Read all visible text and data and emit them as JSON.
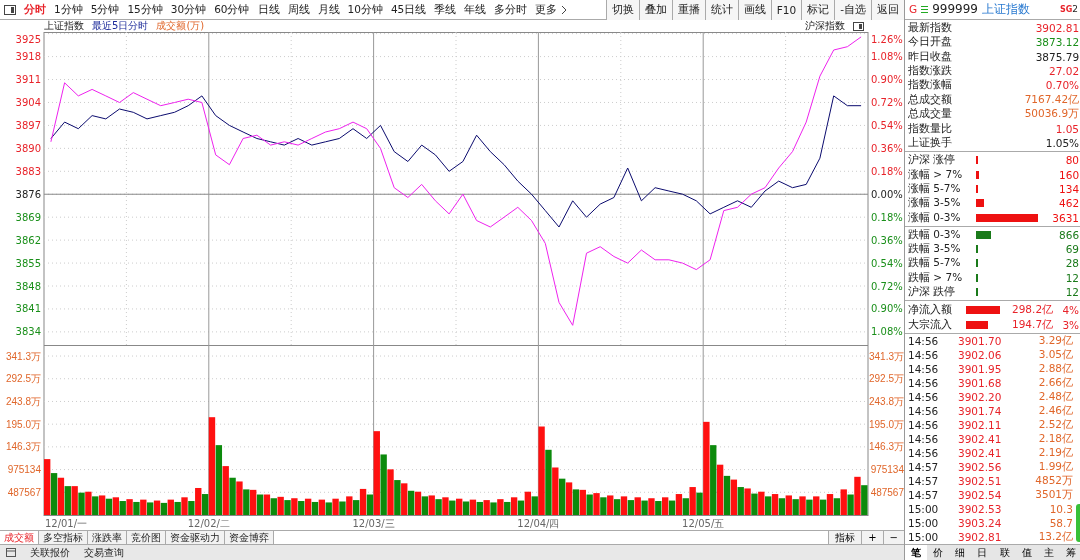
{
  "toolbar": {
    "periods": [
      {
        "label": "分时",
        "selected": true
      },
      {
        "label": "1分钟",
        "selected": false
      },
      {
        "label": "5分钟",
        "selected": false
      },
      {
        "label": "15分钟",
        "selected": false
      },
      {
        "label": "30分钟",
        "selected": false
      },
      {
        "label": "60分钟",
        "selected": false
      },
      {
        "label": "日线",
        "selected": false
      },
      {
        "label": "周线",
        "selected": false
      },
      {
        "label": "月线",
        "selected": false
      },
      {
        "label": "10分钟",
        "selected": false
      },
      {
        "label": "45日线",
        "selected": false
      },
      {
        "label": "季线",
        "selected": false
      },
      {
        "label": "年线",
        "selected": false
      },
      {
        "label": "多分时",
        "selected": false
      },
      {
        "label": "更多",
        "selected": false
      }
    ],
    "actions": [
      "切换",
      "叠加",
      "重播",
      "统计",
      "画线",
      "F10",
      "标记",
      "-自选",
      "返回"
    ]
  },
  "chart_header": {
    "subtitle": "最近5日分时",
    "measure": "成交额(万)"
  },
  "price_chart": {
    "chart_data": {
      "type": "line",
      "grid": true,
      "ylim": [
        3830,
        3925.5
      ],
      "yticks": [
        {
          "value": 3925,
          "label": "3925"
        },
        {
          "value": 3918,
          "label": "3918"
        },
        {
          "value": 3911,
          "label": "3911"
        },
        {
          "value": 3904,
          "label": "3904"
        },
        {
          "value": 3897,
          "label": "3897"
        },
        {
          "value": 3890,
          "label": "3890"
        },
        {
          "value": 3883,
          "label": "3883"
        },
        {
          "value": 3876,
          "label": "3876"
        },
        {
          "value": 3869,
          "label": "3869"
        },
        {
          "value": 3862,
          "label": "3862"
        },
        {
          "value": 3855,
          "label": "3855"
        },
        {
          "value": 3848,
          "label": "3848"
        },
        {
          "value": 3841,
          "label": "3841"
        },
        {
          "value": 3834,
          "label": "3834"
        }
      ],
      "ref_lines": [
        {
          "axis": "y",
          "value": 3876
        }
      ],
      "series": [
        {
          "name": "上证指数",
          "color": "#0b0b6e",
          "values": [
            3893,
            3898,
            3896,
            3900,
            3899,
            3902,
            3901,
            3899,
            3900,
            3901,
            3903,
            3906,
            3900,
            3897,
            3895,
            3893,
            3892,
            3891,
            3893,
            3891,
            3892,
            3893,
            3896,
            3893,
            3897,
            3889,
            3886,
            3891,
            3888,
            3883,
            3886,
            3894,
            3889,
            3885,
            3880,
            3876,
            3871,
            3866,
            3874,
            3869,
            3873,
            3875,
            3884,
            3874,
            3878,
            3877,
            3876,
            3874,
            3870,
            3872,
            3874,
            3872,
            3877,
            3880,
            3878,
            3879,
            3887,
            3906,
            3903,
            3903
          ]
        },
        {
          "name": "沪深指数",
          "color": "#ee22ee",
          "values": [
            3892,
            3910,
            3906,
            3908,
            3906,
            3904,
            3907,
            3905,
            3903,
            3904,
            3905,
            3904,
            3888,
            3885,
            3893,
            3894,
            3891,
            3892,
            3891,
            3893,
            3895,
            3896,
            3898,
            3896,
            3890,
            3878,
            3875,
            3879,
            3874,
            3870,
            3876,
            3868,
            3866,
            3869,
            3872,
            3868,
            3861,
            3843,
            3836,
            3858,
            3860,
            3857,
            3855,
            3859,
            3856,
            3856,
            3855,
            3853,
            3856,
            3871,
            3872,
            3876,
            3878,
            3884,
            3889,
            3898,
            3912,
            3920,
            3921,
            3924
          ]
        }
      ]
    },
    "right_axis": [
      {
        "label": "1.26%",
        "kind": "up"
      },
      {
        "label": "1.08%",
        "kind": "up"
      },
      {
        "label": "0.90%",
        "kind": "up"
      },
      {
        "label": "0.72%",
        "kind": "up"
      },
      {
        "label": "0.54%",
        "kind": "up"
      },
      {
        "label": "0.36%",
        "kind": "up"
      },
      {
        "label": "0.18%",
        "kind": "up"
      },
      {
        "label": "0.00%",
        "kind": "flat"
      },
      {
        "label": "0.18%",
        "kind": "down"
      },
      {
        "label": "0.36%",
        "kind": "down"
      },
      {
        "label": "0.54%",
        "kind": "down"
      },
      {
        "label": "0.72%",
        "kind": "down"
      },
      {
        "label": "0.90%",
        "kind": "down"
      },
      {
        "label": "1.08%",
        "kind": "down"
      }
    ]
  },
  "volume_chart": {
    "chart_data": {
      "type": "bar",
      "grid": true,
      "ylim": [
        0,
        3650000
      ],
      "yticks": [
        975134,
        487567
      ],
      "series": [
        {
          "color": "#ff1010",
          "values": [
            1200000,
            800000,
            620000,
            500000,
            420000,
            380000,
            340000,
            330000,
            310000,
            330000,
            380000,
            580000,
            2100000,
            1050000,
            720000,
            540000,
            440000,
            390000,
            360000,
            350000,
            330000,
            350000,
            400000,
            560000,
            1800000,
            980000,
            680000,
            500000,
            420000,
            380000,
            350000,
            330000,
            320000,
            340000,
            380000,
            500000,
            1900000,
            1020000,
            700000,
            540000,
            470000,
            420000,
            400000,
            380000,
            360000,
            380000,
            450000,
            600000,
            2000000,
            1080000,
            760000,
            570000,
            500000,
            450000,
            420000,
            400000,
            400000,
            450000,
            550000,
            820000
          ]
        },
        {
          "color": "#0c8a0c",
          "values": [
            900000,
            620000,
            480000,
            400000,
            350000,
            300000,
            280000,
            270000,
            260000,
            280000,
            300000,
            450000,
            1500000,
            800000,
            550000,
            440000,
            360000,
            320000,
            300000,
            280000,
            270000,
            290000,
            320000,
            440000,
            1300000,
            750000,
            520000,
            400000,
            340000,
            310000,
            290000,
            280000,
            270000,
            280000,
            310000,
            400000,
            1400000,
            780000,
            550000,
            440000,
            380000,
            340000,
            320000,
            310000,
            300000,
            310000,
            360000,
            480000,
            1500000,
            840000,
            600000,
            460000,
            400000,
            360000,
            340000,
            330000,
            330000,
            360000,
            440000,
            640000
          ]
        }
      ]
    },
    "left_axis": [
      "341.3万",
      "292.5万",
      "243.8万",
      "195.0万",
      "146.3万"
    ],
    "right_axis": [
      "341.3万",
      "292.5万",
      "243.8万",
      "195.0万",
      "146.3万",
      "975134",
      "487567"
    ],
    "date_axis": [
      "12/01/一",
      "12/02/二",
      "12/03/三",
      "12/04/四",
      "12/05/五"
    ]
  },
  "indicator_tabs": [
    {
      "label": "成交额",
      "selected": true
    },
    {
      "label": "多空指标",
      "selected": false
    },
    {
      "label": "涨跌率",
      "selected": false
    },
    {
      "label": "竞价图",
      "selected": false
    },
    {
      "label": "资金驱动力",
      "selected": false
    },
    {
      "label": "资金博弈",
      "selected": false
    }
  ],
  "indicator_controls": [
    "指标",
    "+",
    "−"
  ],
  "bottom_bar": [
    "关联报价",
    "交易查询"
  ],
  "quote_panel": {
    "market": "G",
    "code": "999999",
    "name": "上证指数",
    "badge": "SG",
    "badge_number": "2",
    "stats": [
      {
        "label": "最新指数",
        "value": "3902.81",
        "color": "#e8232a"
      },
      {
        "label": "今日开盘",
        "value": "3873.12",
        "color": "#1a8f1a"
      },
      {
        "label": "昨日收盘",
        "value": "3875.79",
        "color": "#222222"
      },
      {
        "label": "指数涨跌",
        "value": "27.02",
        "color": "#e8232a"
      },
      {
        "label": "指数涨幅",
        "value": "0.70%",
        "color": "#e8232a"
      },
      {
        "label": "总成交额",
        "value": "7167.42亿",
        "color": "#e0662a"
      },
      {
        "label": "总成交量",
        "value": "50036.9万",
        "color": "#e0662a"
      },
      {
        "label": "指数量比",
        "value": "1.05",
        "color": "#e8232a"
      },
      {
        "label": "上证换手",
        "value": "1.05%",
        "color": "#222222"
      }
    ],
    "breadth": [
      {
        "label": "沪深 涨停",
        "count": "80",
        "color": "#ee1111"
      },
      {
        "label": "涨幅 > 7%",
        "count": "160",
        "color": "#ee1111"
      },
      {
        "label": "涨幅 5-7%",
        "count": "134",
        "color": "#ee1111"
      },
      {
        "label": "涨幅 3-5%",
        "count": "462",
        "color": "#ee1111"
      },
      {
        "label": "涨幅 0-3%",
        "count": "3631",
        "color": "#ee1111"
      },
      {
        "label": "跌幅 0-3%",
        "count": "866",
        "color": "#1a7a1a"
      },
      {
        "label": "跌幅 3-5%",
        "count": "69",
        "color": "#1a7a1a"
      },
      {
        "label": "跌幅 5-7%",
        "count": "28",
        "color": "#1a7a1a"
      },
      {
        "label": "跌幅 > 7%",
        "count": "12",
        "color": "#1a7a1a"
      },
      {
        "label": "沪深 跌停",
        "count": "12",
        "color": "#1a7a1a"
      }
    ],
    "flows": [
      {
        "label": "净流入额",
        "amount": "298.2亿",
        "share": "4%"
      },
      {
        "label": "大宗流入",
        "amount": "194.7亿",
        "share": "3%"
      }
    ],
    "ticks": [
      {
        "time": "14:56",
        "price": "3901.70",
        "volume": "3.29亿"
      },
      {
        "time": "14:56",
        "price": "3902.06",
        "volume": "3.05亿"
      },
      {
        "time": "14:56",
        "price": "3901.95",
        "volume": "2.88亿"
      },
      {
        "time": "14:56",
        "price": "3901.68",
        "volume": "2.66亿"
      },
      {
        "time": "14:56",
        "price": "3902.20",
        "volume": "2.48亿"
      },
      {
        "time": "14:56",
        "price": "3901.74",
        "volume": "2.46亿"
      },
      {
        "time": "14:56",
        "price": "3902.11",
        "volume": "2.52亿"
      },
      {
        "time": "14:56",
        "price": "3902.41",
        "volume": "2.18亿"
      },
      {
        "time": "14:56",
        "price": "3902.41",
        "volume": "2.19亿"
      },
      {
        "time": "14:57",
        "price": "3902.56",
        "volume": "1.99亿"
      },
      {
        "time": "14:57",
        "price": "3902.51",
        "volume": "4852万"
      },
      {
        "time": "14:57",
        "price": "3902.54",
        "volume": "3501万"
      },
      {
        "time": "15:00",
        "price": "3902.53",
        "volume": "10.3"
      },
      {
        "time": "15:00",
        "price": "3903.24",
        "volume": "58.7"
      },
      {
        "time": "15:00",
        "price": "3902.81",
        "volume": "13.2亿"
      }
    ],
    "tabs": [
      {
        "label": "笔",
        "selected": true
      },
      {
        "label": "价",
        "selected": false
      },
      {
        "label": "细",
        "selected": false
      },
      {
        "label": "日",
        "selected": false
      },
      {
        "label": "联",
        "selected": false
      },
      {
        "label": "值",
        "selected": false
      },
      {
        "label": "主",
        "selected": false
      },
      {
        "label": "筹",
        "selected": false
      }
    ]
  }
}
